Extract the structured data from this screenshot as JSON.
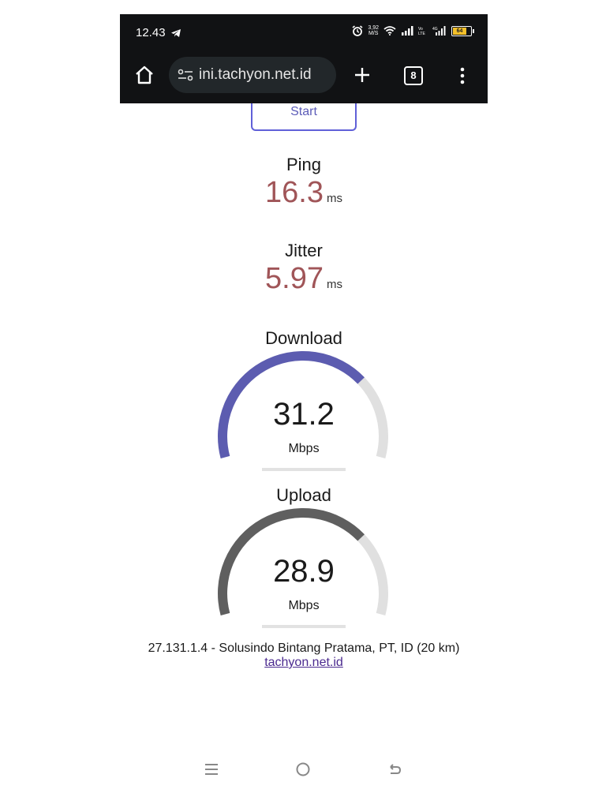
{
  "status_bar": {
    "time": "12.43",
    "net_speed_value": "3,92",
    "net_speed_unit": "M/S",
    "battery": "64",
    "icons": [
      "telegram-icon",
      "alarm-icon",
      "wifi-icon",
      "signal-icon",
      "volte-icon",
      "4g-signal-icon",
      "battery-icon"
    ]
  },
  "browser": {
    "url": "ini.tachyon.net.id",
    "tab_count": "8",
    "icons": [
      "home-icon",
      "site-settings-icon",
      "plus-icon",
      "tabs-icon",
      "more-vert-icon"
    ]
  },
  "start_button": "Start",
  "ping": {
    "label": "Ping",
    "value": "16.3",
    "unit": "ms"
  },
  "jitter": {
    "label": "Jitter",
    "value": "5.97",
    "unit": "ms"
  },
  "download": {
    "label": "Download",
    "value": "31.2",
    "unit": "Mbps",
    "gauge_fraction": 0.72,
    "color": "#5c5cb0"
  },
  "upload": {
    "label": "Upload",
    "value": "28.9",
    "unit": "Mbps",
    "gauge_fraction": 0.72,
    "color": "#5f5f5f"
  },
  "server_info": "27.131.1.4 - Solusindo Bintang Pratama, PT, ID (20 km)",
  "site_link": "tachyon.net.id",
  "colors": {
    "accent": "#6060d8",
    "value_red": "#a05558",
    "gauge_track": "#e0e0e0"
  },
  "nav_bar": {
    "icons": [
      "recents-icon",
      "home-circle-icon",
      "back-icon"
    ]
  }
}
